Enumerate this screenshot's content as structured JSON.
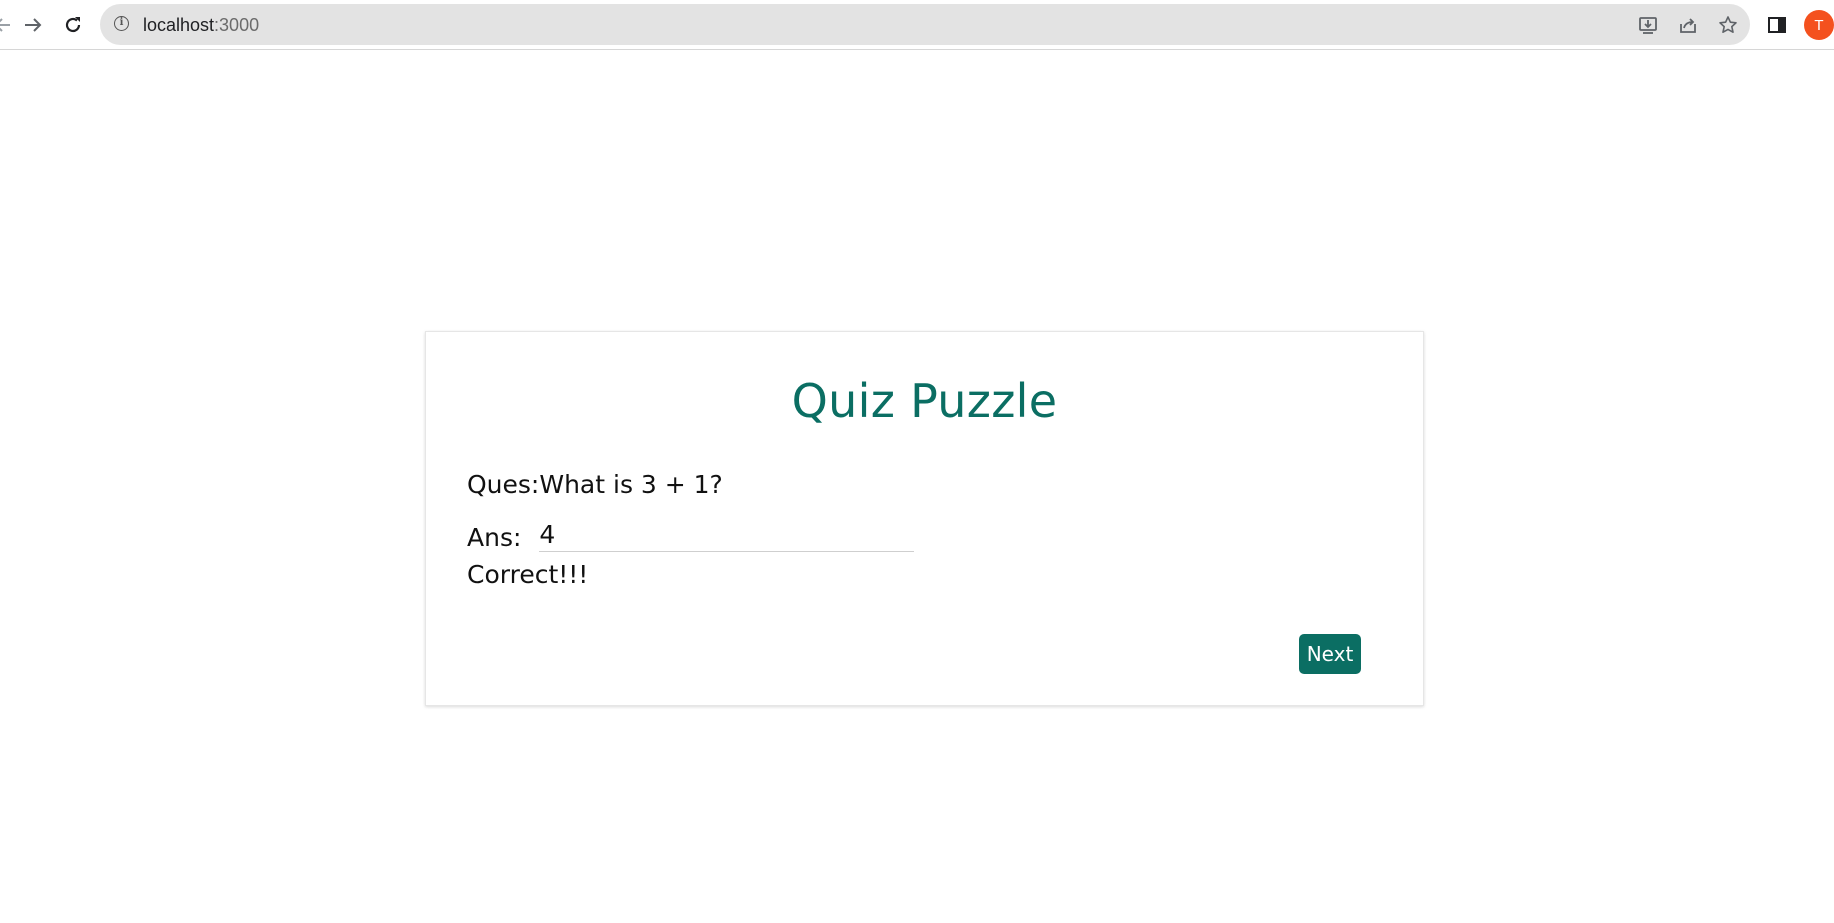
{
  "browser": {
    "url_host": "localhost",
    "url_port": ":3000",
    "profile_initial": "T"
  },
  "quiz": {
    "title": "Quiz Puzzle",
    "question_prefix": "Ques:",
    "question_text": "What is 3 + 1?",
    "answer_label": "Ans:",
    "answer_value": "4",
    "result_text": "Correct!!!",
    "next_label": "Next"
  },
  "colors": {
    "accent": "#0b6e63",
    "avatar": "#f4511e"
  }
}
